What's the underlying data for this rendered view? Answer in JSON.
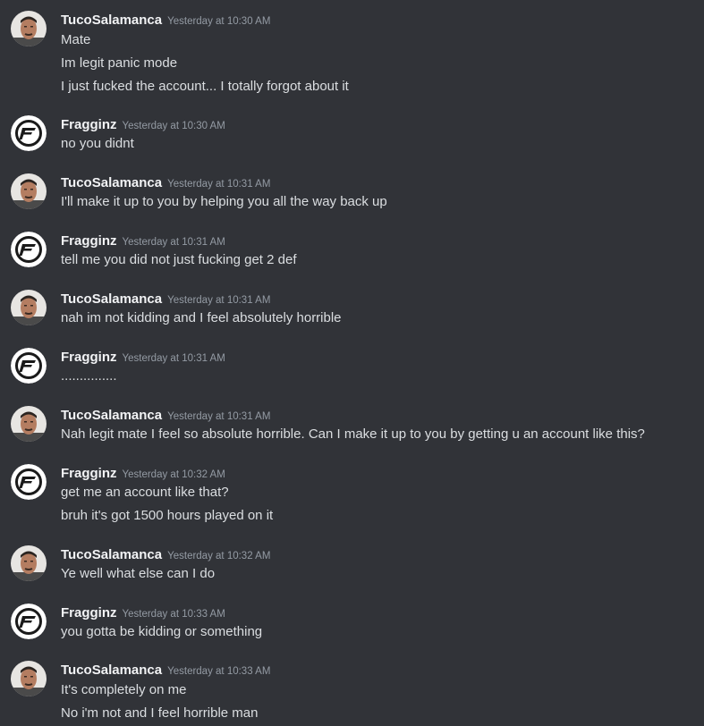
{
  "users": {
    "tuco": "TucoSalamanca",
    "fragginz": "Fragginz"
  },
  "messages": [
    {
      "user": "TucoSalamanca",
      "time": "Yesterday at 10:30 AM",
      "avatar": "portrait-avatar",
      "lines": [
        "Mate",
        "Im legit panic mode",
        "I just fucked the account... I totally forgot about it"
      ]
    },
    {
      "user": "Fragginz",
      "time": "Yesterday at 10:30 AM",
      "avatar": "fragginz-logo-avatar",
      "lines": [
        "no you didnt"
      ]
    },
    {
      "user": "TucoSalamanca",
      "time": "Yesterday at 10:31 AM",
      "avatar": "portrait-avatar",
      "lines": [
        "I'll make it up to you by helping you all the way back up"
      ]
    },
    {
      "user": "Fragginz",
      "time": "Yesterday at 10:31 AM",
      "avatar": "fragginz-logo-avatar",
      "lines": [
        "tell me you did not just fucking get 2 def"
      ]
    },
    {
      "user": "TucoSalamanca",
      "time": "Yesterday at 10:31 AM",
      "avatar": "portrait-avatar",
      "lines": [
        "nah im not kidding and I feel absolutely horrible"
      ]
    },
    {
      "user": "Fragginz",
      "time": "Yesterday at 10:31 AM",
      "avatar": "fragginz-logo-avatar",
      "lines": [
        "..............."
      ]
    },
    {
      "user": "TucoSalamanca",
      "time": "Yesterday at 10:31 AM",
      "avatar": "portrait-avatar",
      "lines": [
        "Nah legit mate I feel so absolute horrible. Can I make it up to you by getting u an account like this?"
      ]
    },
    {
      "user": "Fragginz",
      "time": "Yesterday at 10:32 AM",
      "avatar": "fragginz-logo-avatar",
      "lines": [
        "get me an account like that?",
        "bruh it's got 1500 hours played on it"
      ]
    },
    {
      "user": "TucoSalamanca",
      "time": "Yesterday at 10:32 AM",
      "avatar": "portrait-avatar",
      "lines": [
        "Ye well what else can I do"
      ]
    },
    {
      "user": "Fragginz",
      "time": "Yesterday at 10:33 AM",
      "avatar": "fragginz-logo-avatar",
      "lines": [
        "you gotta be kidding or something"
      ]
    },
    {
      "user": "TucoSalamanca",
      "time": "Yesterday at 10:33 AM",
      "avatar": "portrait-avatar",
      "lines": [
        "It's completely on me",
        "No i'm not and I feel horrible man"
      ]
    }
  ],
  "colors": {
    "background": "#313338",
    "username": "#f2f3f5",
    "timestamp": "#949ba4",
    "text": "#dbdee1"
  }
}
